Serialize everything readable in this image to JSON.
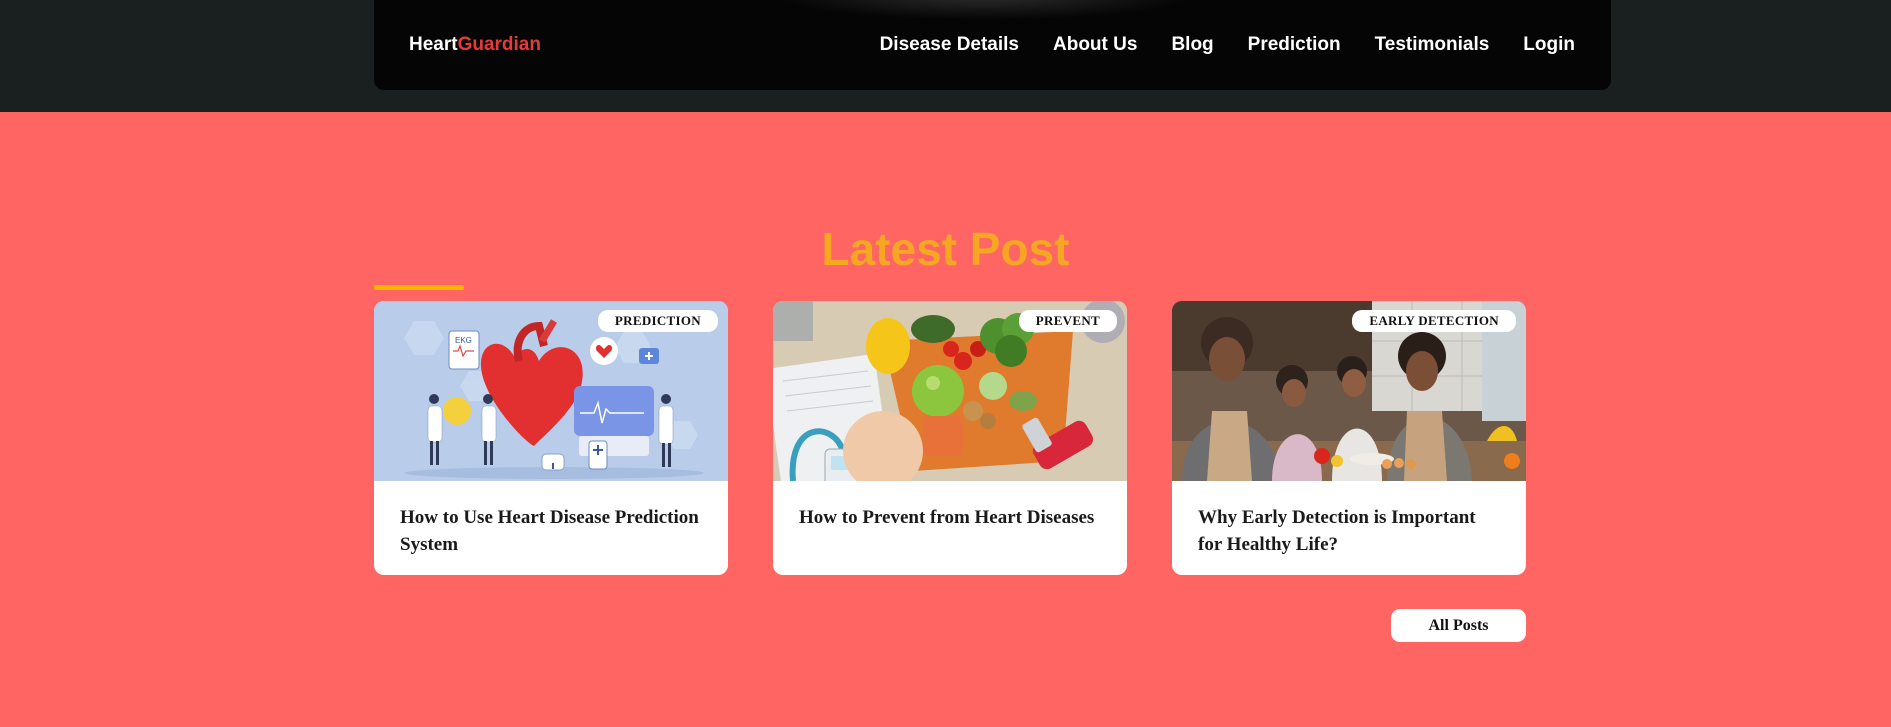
{
  "brand": {
    "part1": "Heart",
    "part2": "Guardian"
  },
  "nav": [
    {
      "label": "Disease Details"
    },
    {
      "label": "About Us"
    },
    {
      "label": "Blog"
    },
    {
      "label": "Prediction"
    },
    {
      "label": "Testimonials"
    },
    {
      "label": "Login"
    }
  ],
  "section": {
    "title": "Latest Post"
  },
  "posts": [
    {
      "tag": "PREDICTION",
      "title": "How to Use Heart Disease Prediction System",
      "image": "heart-illustration"
    },
    {
      "tag": "PREVENT",
      "title": "How to Prevent from Heart Diseases",
      "image": "healthy-food"
    },
    {
      "tag": "EARLY DETECTION",
      "title": "Why Early Detection is Important for Healthy Life?",
      "image": "family-kitchen"
    }
  ],
  "all_posts_label": "All Posts",
  "colors": {
    "page_bg": "#ff6563",
    "header_bg": "#050505",
    "brand_accent": "#e83a3a",
    "title": "#f5a623"
  }
}
